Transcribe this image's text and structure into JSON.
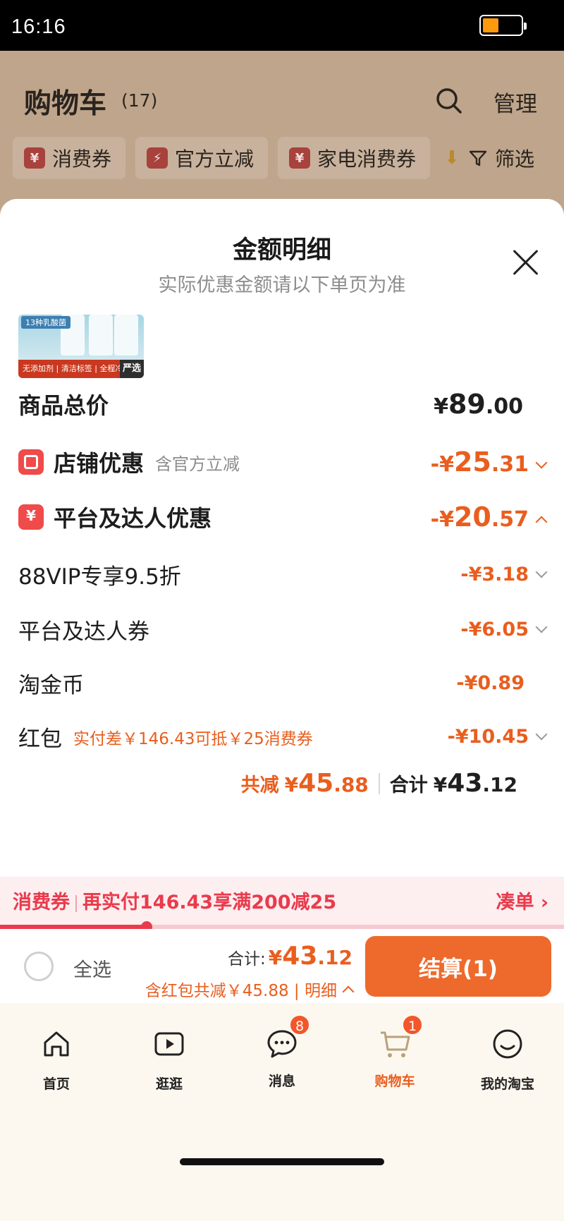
{
  "status_bar": {
    "time": "16:16",
    "battery_level": 0.4
  },
  "cart_header": {
    "title": "购物车",
    "count": "(17)",
    "manage": "管理",
    "chips": [
      {
        "label": "消费券",
        "icon": "yen-voucher-icon"
      },
      {
        "label": "官方立减",
        "icon": "lightning-icon"
      },
      {
        "label": "家电消费券",
        "icon": "yen-voucher-icon"
      }
    ],
    "filter": "筛选"
  },
  "sheet": {
    "title": "金额明细",
    "subtitle": "实际优惠金额请以下单页为准",
    "product_thumb": {
      "tag": "13种乳酸菌",
      "strip": "无添加剂 | 清洁标签 | 全程冷链",
      "badge": "严选"
    },
    "goods_total": {
      "label": "商品总价",
      "yen": "¥",
      "int": "89",
      "dec": ".00"
    },
    "shop_discount": {
      "label": "店铺优惠",
      "note": "含官方立减",
      "yen": "-¥",
      "int": "25",
      "dec": ".31"
    },
    "platform_discount": {
      "label": "平台及达人优惠",
      "yen": "-¥",
      "int": "20",
      "dec": ".57"
    },
    "items": [
      {
        "label": "88VIP专享9.5折",
        "amount": "-¥3.18",
        "chevron": true
      },
      {
        "label": "平台及达人券",
        "amount": "-¥6.05",
        "chevron": true
      },
      {
        "label": "淘金币",
        "amount": "-¥0.89",
        "chevron": false
      },
      {
        "label": "红包",
        "note": "实付差￥146.43可抵￥25消费券",
        "amount": "-¥10.45",
        "chevron": true
      }
    ],
    "total_reduce": {
      "label": "共减",
      "yen": "¥",
      "int": "45",
      "dec": ".88"
    },
    "total": {
      "label": "合计",
      "yen": "¥",
      "int": "43",
      "dec": ".12"
    }
  },
  "voucher_bar": {
    "label": "消费券",
    "text": "再实付146.43享满200减25",
    "link": "凑单",
    "progress": 0.26
  },
  "checkout": {
    "select_all": "全选",
    "sum_label": "合计:",
    "sum_yen": "¥",
    "sum_int": "43",
    "sum_dec": ".12",
    "sum_sub": "含红包共减￥45.88 | 明细",
    "button": "结算(1)"
  },
  "tabbar": [
    {
      "label": "首页",
      "icon": "home-icon"
    },
    {
      "label": "逛逛",
      "icon": "play-icon"
    },
    {
      "label": "消息",
      "icon": "message-icon",
      "badge": "8"
    },
    {
      "label": "购物车",
      "icon": "cart-icon",
      "badge": "1",
      "active": true
    },
    {
      "label": "我的淘宝",
      "icon": "smiley-icon"
    }
  ],
  "colors": {
    "accent": "#e95e1e",
    "voucher_red": "#e93b4c",
    "pay_button": "#ee6a2c"
  }
}
